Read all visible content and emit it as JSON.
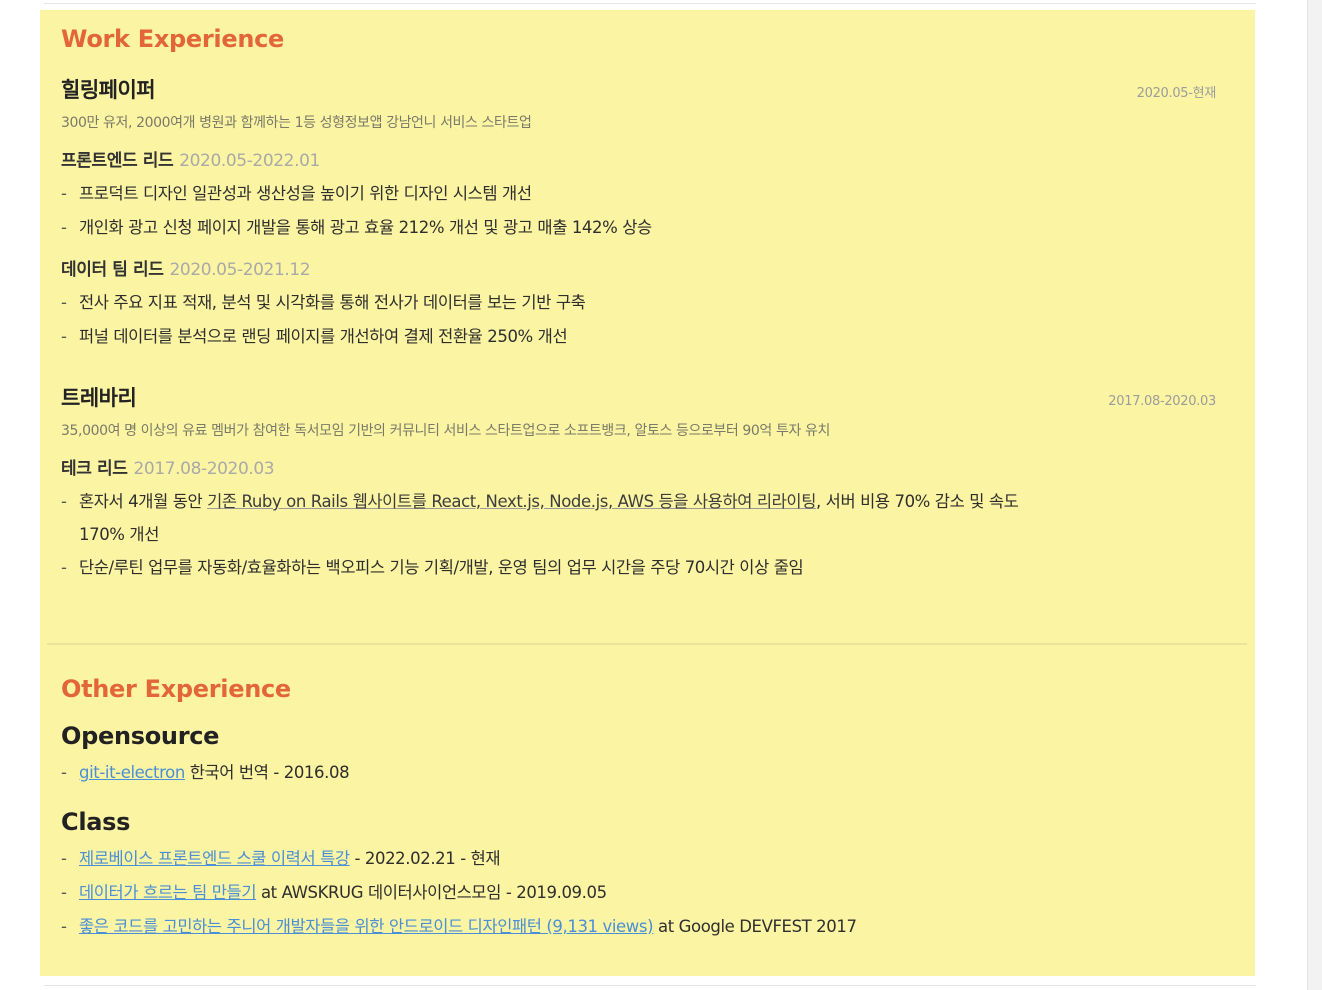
{
  "work": {
    "title": "Work Experience",
    "companies": [
      {
        "name": "힐링페이퍼",
        "period": "2020.05-현재",
        "desc": "300만 유저, 2000여개 병원과 함께하는 1등 성형정보앱 강남언니 서비스 스타트업",
        "roles": [
          {
            "title": "프론트엔드 리드",
            "period": "2020.05-2022.01",
            "bullets": [
              "프로덕트 디자인 일관성과 생산성을 높이기 위한 디자인 시스템 개선",
              "개인화 광고 신청 페이지 개발을 통해 광고 효율 212% 개선 및 광고 매출 142% 상승"
            ]
          },
          {
            "title": "데이터 팀 리드",
            "period": "2020.05-2021.12",
            "bullets": [
              "전사 주요 지표 적재, 분석 및 시각화를 통해 전사가 데이터를 보는 기반 구축",
              "퍼널 데이터를 분석으로 랜딩 페이지를 개선하여 결제 전환율 250% 개선"
            ]
          }
        ]
      },
      {
        "name": "트레바리",
        "period": "2017.08-2020.03",
        "desc": "35,000여 명 이상의 유료 멤버가 참여한 독서모임 기반의 커뮤니티 서비스 스타트업으로 소프트뱅크, 알토스 등으로부터 90억 투자 유치",
        "roles": [
          {
            "title": "테크 리드",
            "period": "2017.08-2020.03",
            "bullets": [
              {
                "pre": "혼자서 4개월 동안 ",
                "link": "기존 Ruby on Rails 웹사이트를 React, Next.js, Node.js, AWS 등을 사용하여 리라이팅",
                "post": ", 서버 비용 70% 감소 및 속도",
                "cont": "170% 개선"
              },
              "단순/루틴 업무를 자동화/효율화하는 백오피스 기능 기획/개발, 운영 팀의 업무 시간을 주당 70시간 이상 줄임"
            ]
          }
        ]
      }
    ]
  },
  "other": {
    "title": "Other Experience",
    "opensource": {
      "heading": "Opensource",
      "items": [
        {
          "link": "git-it-electron",
          "text": " 한국어 번역 - 2016.08"
        }
      ]
    },
    "class": {
      "heading": "Class",
      "items": [
        {
          "link": "제로베이스 프론트엔드 스쿨 이력서 특강",
          "text": " - 2022.02.21 - 현재"
        },
        {
          "link": "데이터가 흐르는 팀 만들기",
          "text": " at AWSKRUG 데이터사이언스모임 - 2019.09.05"
        },
        {
          "link": "좋은 코드를 고민하는 주니어 개발자들을 위한 안드로이드 디자인패턴 (9,131 views)",
          "text": " at Google DEVFEST 2017"
        }
      ]
    }
  },
  "colors": {
    "card_bg": "#fbf4a2",
    "section_title": "#e2663a",
    "link_blue": "#4a8fd8"
  }
}
